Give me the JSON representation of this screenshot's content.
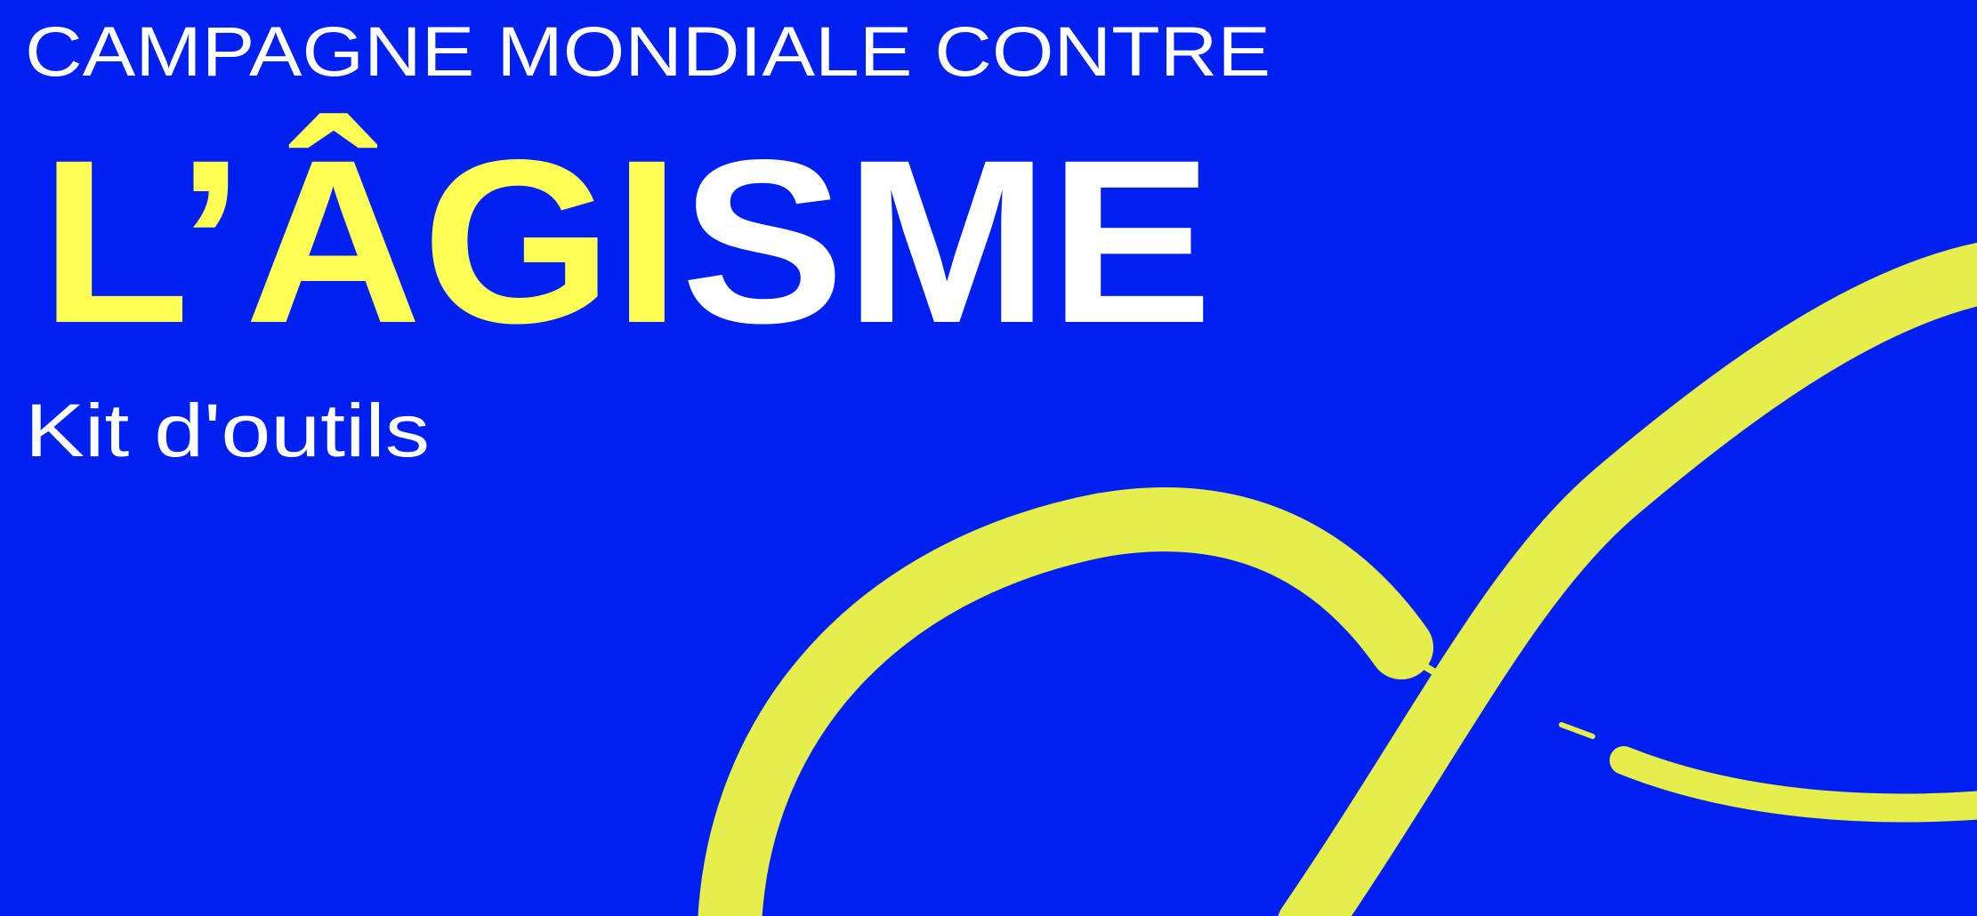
{
  "header": {
    "supertitle": "CAMPAGNE MONDIALE CONTRE",
    "title_part_yellow": "L’ÂGI",
    "title_part_white": "SME",
    "subtitle": "Kit d'outils"
  },
  "colors": {
    "background": "#0020f0",
    "title_yellow": "#ffff55",
    "brush_yellow": "#e6ee4c",
    "text_white": "#ffffff"
  }
}
